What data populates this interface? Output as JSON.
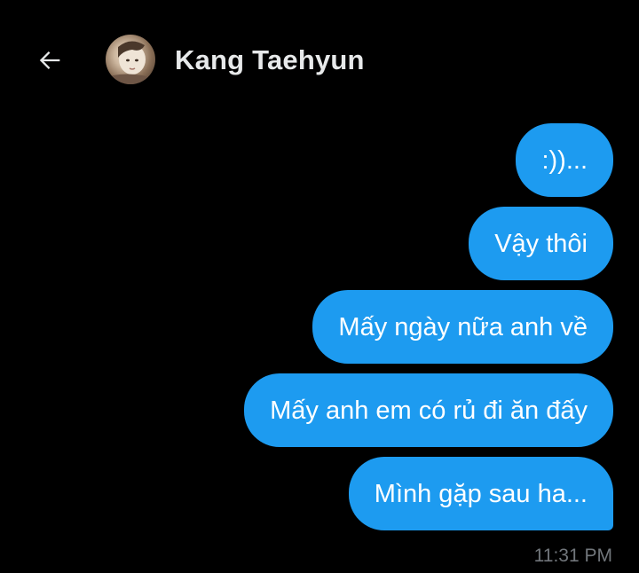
{
  "header": {
    "back_icon": "arrow-left-icon",
    "contact_name": "Kang Taehyun",
    "avatar_icon": "user-avatar"
  },
  "messages": [
    {
      "text": ":))..."
    },
    {
      "text": "Vậy thôi"
    },
    {
      "text": "Mấy ngày nữa anh về"
    },
    {
      "text": "Mấy anh em có rủ đi ăn đấy"
    },
    {
      "text": "Mình gặp sau ha..."
    }
  ],
  "timestamp": "11:31 PM",
  "colors": {
    "background": "#000000",
    "bubble": "#1d9bf0",
    "bubble_text": "#ffffff",
    "name_text": "#e7e9ea",
    "timestamp_text": "#71767b"
  }
}
